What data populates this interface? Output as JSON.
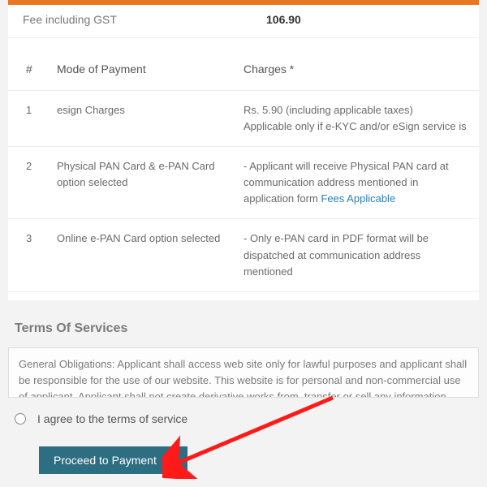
{
  "fee": {
    "label": "Fee including GST",
    "value": "106.90"
  },
  "charges_table": {
    "headers": {
      "num": "#",
      "mode": "Mode of Payment",
      "charges": "Charges *"
    },
    "rows": [
      {
        "num": "1",
        "mode": "esign Charges",
        "charge_line1": "Rs. 5.90 (including applicable taxes)",
        "charge_line2": "Applicable only if e-KYC and/or eSign service is"
      },
      {
        "num": "2",
        "mode": "Physical PAN Card & e-PAN Card option selected",
        "charge_prefix": "- Applicant will receive Physical PAN card at communication address mentioned in application form ",
        "charge_link": "Fees Applicable"
      },
      {
        "num": "3",
        "mode": "Online e-PAN Card option selected",
        "charge_text": "- Only e-PAN card in PDF format will be dispatched at communication address mentioned"
      }
    ]
  },
  "terms": {
    "title": "Terms Of Services",
    "body": "General Obligations: Applicant shall access web site only for lawful purposes and applicant shall be responsible for the use of our website. This website is for personal and non-commercial use of applicant. Applicant shall not create derivative works from, transfer or sell any information, products or services obtained from this website."
  },
  "agree": {
    "label": "I agree to the terms of service"
  },
  "button": {
    "label": "Proceed to Payment"
  }
}
